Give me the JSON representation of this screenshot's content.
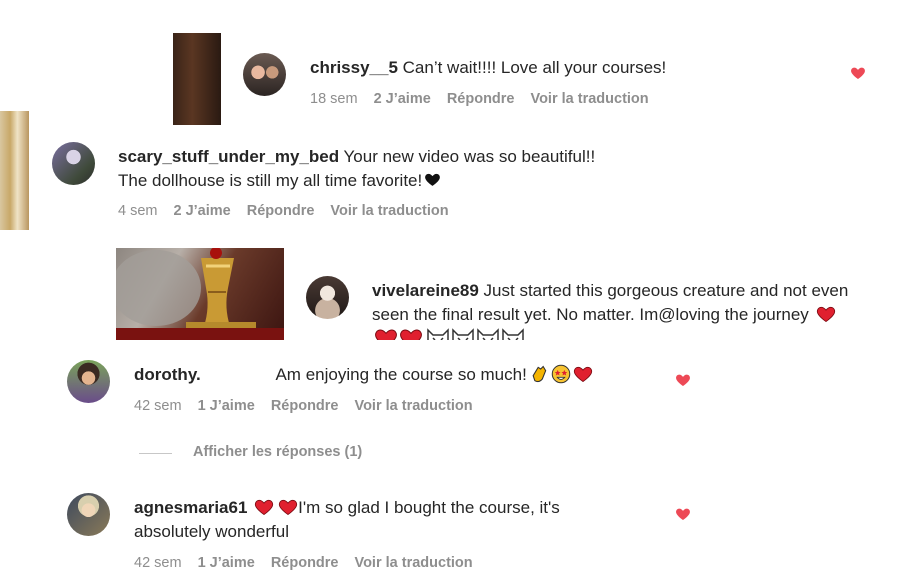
{
  "colors": {
    "text": "#262626",
    "meta": "#8e8e8e",
    "like_heart": "#ed4956",
    "emoji_heart": "#e0202f"
  },
  "comments": [
    {
      "username": "chrissy__5",
      "text": "Can’t wait!!!! Love all your courses!",
      "time": "18 sem",
      "likes": "2 J’aime",
      "reply": "Répondre",
      "translate": "Voir la traduction",
      "liked_by_you": true
    },
    {
      "username": "scary_stuff_under_my_bed",
      "text_line1": "Your new video was so beautiful!!",
      "text_line2": "The dollhouse is still my all time favorite!",
      "time": "4 sem",
      "likes": "2 J’aime",
      "reply": "Répondre",
      "translate": "Voir la traduction",
      "liked_by_you": false
    },
    {
      "username": "vivelareine89",
      "text_line1": "Just started this gorgeous creature and not even",
      "text_line2": "seen the final result yet. No matter. Im@loving the journey",
      "emojis": [
        "heart",
        "heart",
        "heart",
        "cat",
        "cat",
        "cat",
        "cat"
      ],
      "liked_by_you": false
    },
    {
      "username": "dorothy.",
      "text": "Am enjoying the course so much!",
      "emojis": [
        "clapping-hands",
        "star-struck",
        "heart"
      ],
      "time": "42 sem",
      "likes": "1 J’aime",
      "reply": "Répondre",
      "translate": "Voir la traduction",
      "liked_by_you": true,
      "view_replies": "Afficher les réponses (1)"
    },
    {
      "username": "agnesmaria61",
      "text_line1": "I'm so glad I bought the course, it's",
      "text_line2": "absolutely wonderful",
      "emojis": [
        "heart",
        "heart"
      ],
      "time": "42 sem",
      "likes": "1 J’aime",
      "reply": "Répondre",
      "translate": "Voir la traduction",
      "liked_by_you": true
    }
  ]
}
